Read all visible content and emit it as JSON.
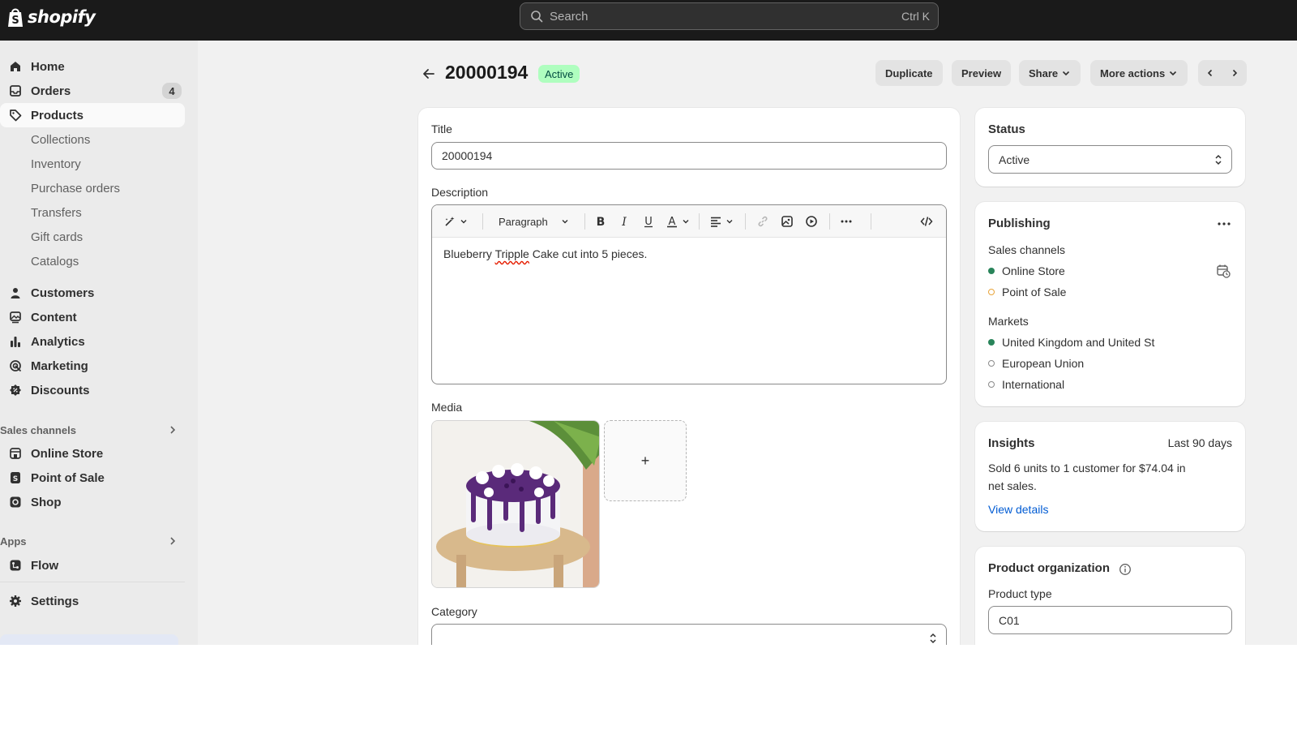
{
  "topbar": {
    "brand": "shopify",
    "search_placeholder": "Search",
    "search_shortcut": "Ctrl K"
  },
  "sidebar": {
    "main": [
      {
        "label": "Home",
        "icon": "home-icon"
      },
      {
        "label": "Orders",
        "icon": "inbox-icon",
        "badge": "4"
      },
      {
        "label": "Products",
        "icon": "tag-icon",
        "selected": true
      }
    ],
    "products_sub": [
      "Collections",
      "Inventory",
      "Purchase orders",
      "Transfers",
      "Gift cards",
      "Catalogs"
    ],
    "more": [
      {
        "label": "Customers",
        "icon": "person-icon"
      },
      {
        "label": "Content",
        "icon": "content-icon"
      },
      {
        "label": "Analytics",
        "icon": "bar-chart-icon"
      },
      {
        "label": "Marketing",
        "icon": "target-icon"
      },
      {
        "label": "Discounts",
        "icon": "discount-icon"
      }
    ],
    "sales_channels_heading": "Sales channels",
    "sales_channels": [
      {
        "label": "Online Store",
        "icon": "store-icon"
      },
      {
        "label": "Point of Sale",
        "icon": "pos-icon"
      },
      {
        "label": "Shop",
        "icon": "shop-icon"
      }
    ],
    "apps_heading": "Apps",
    "apps": [
      {
        "label": "Flow",
        "icon": "flow-icon"
      }
    ],
    "settings": {
      "label": "Settings",
      "icon": "gear-icon"
    }
  },
  "header": {
    "title": "20000194",
    "status": "Active",
    "buttons": {
      "duplicate": "Duplicate",
      "preview": "Preview",
      "share": "Share",
      "more_actions": "More actions"
    }
  },
  "product": {
    "title_label": "Title",
    "title_value": "20000194",
    "description_label": "Description",
    "toolbar_paragraph": "Paragraph",
    "description_before": "Blueberry ",
    "description_misspelled": "Tripple",
    "description_after": " Cake cut into 5 pieces.",
    "media_label": "Media",
    "media_add": "+",
    "category_label": "Category"
  },
  "status_card": {
    "title": "Status",
    "value": "Active"
  },
  "publishing": {
    "title": "Publishing",
    "sales_channels_label": "Sales channels",
    "channels": [
      "Online Store",
      "Point of Sale"
    ],
    "markets_label": "Markets",
    "markets": [
      "United Kingdom and United St",
      "European Union",
      "International"
    ]
  },
  "insights": {
    "title": "Insights",
    "period": "Last 90 days",
    "summary_line1": "Sold 6 units to 1 customer for $74.04 in",
    "summary_line2": "net sales.",
    "link": "View details"
  },
  "organization": {
    "title": "Product organization",
    "type_label": "Product type",
    "type_value": "C01"
  },
  "colors": {
    "topbar": "#1a1a1a",
    "sidebar": "#ebebeb",
    "canvas": "#f1f1f1",
    "active_badge_bg": "#affebf",
    "published_dot": "#29845a",
    "link": "#005bd3"
  }
}
